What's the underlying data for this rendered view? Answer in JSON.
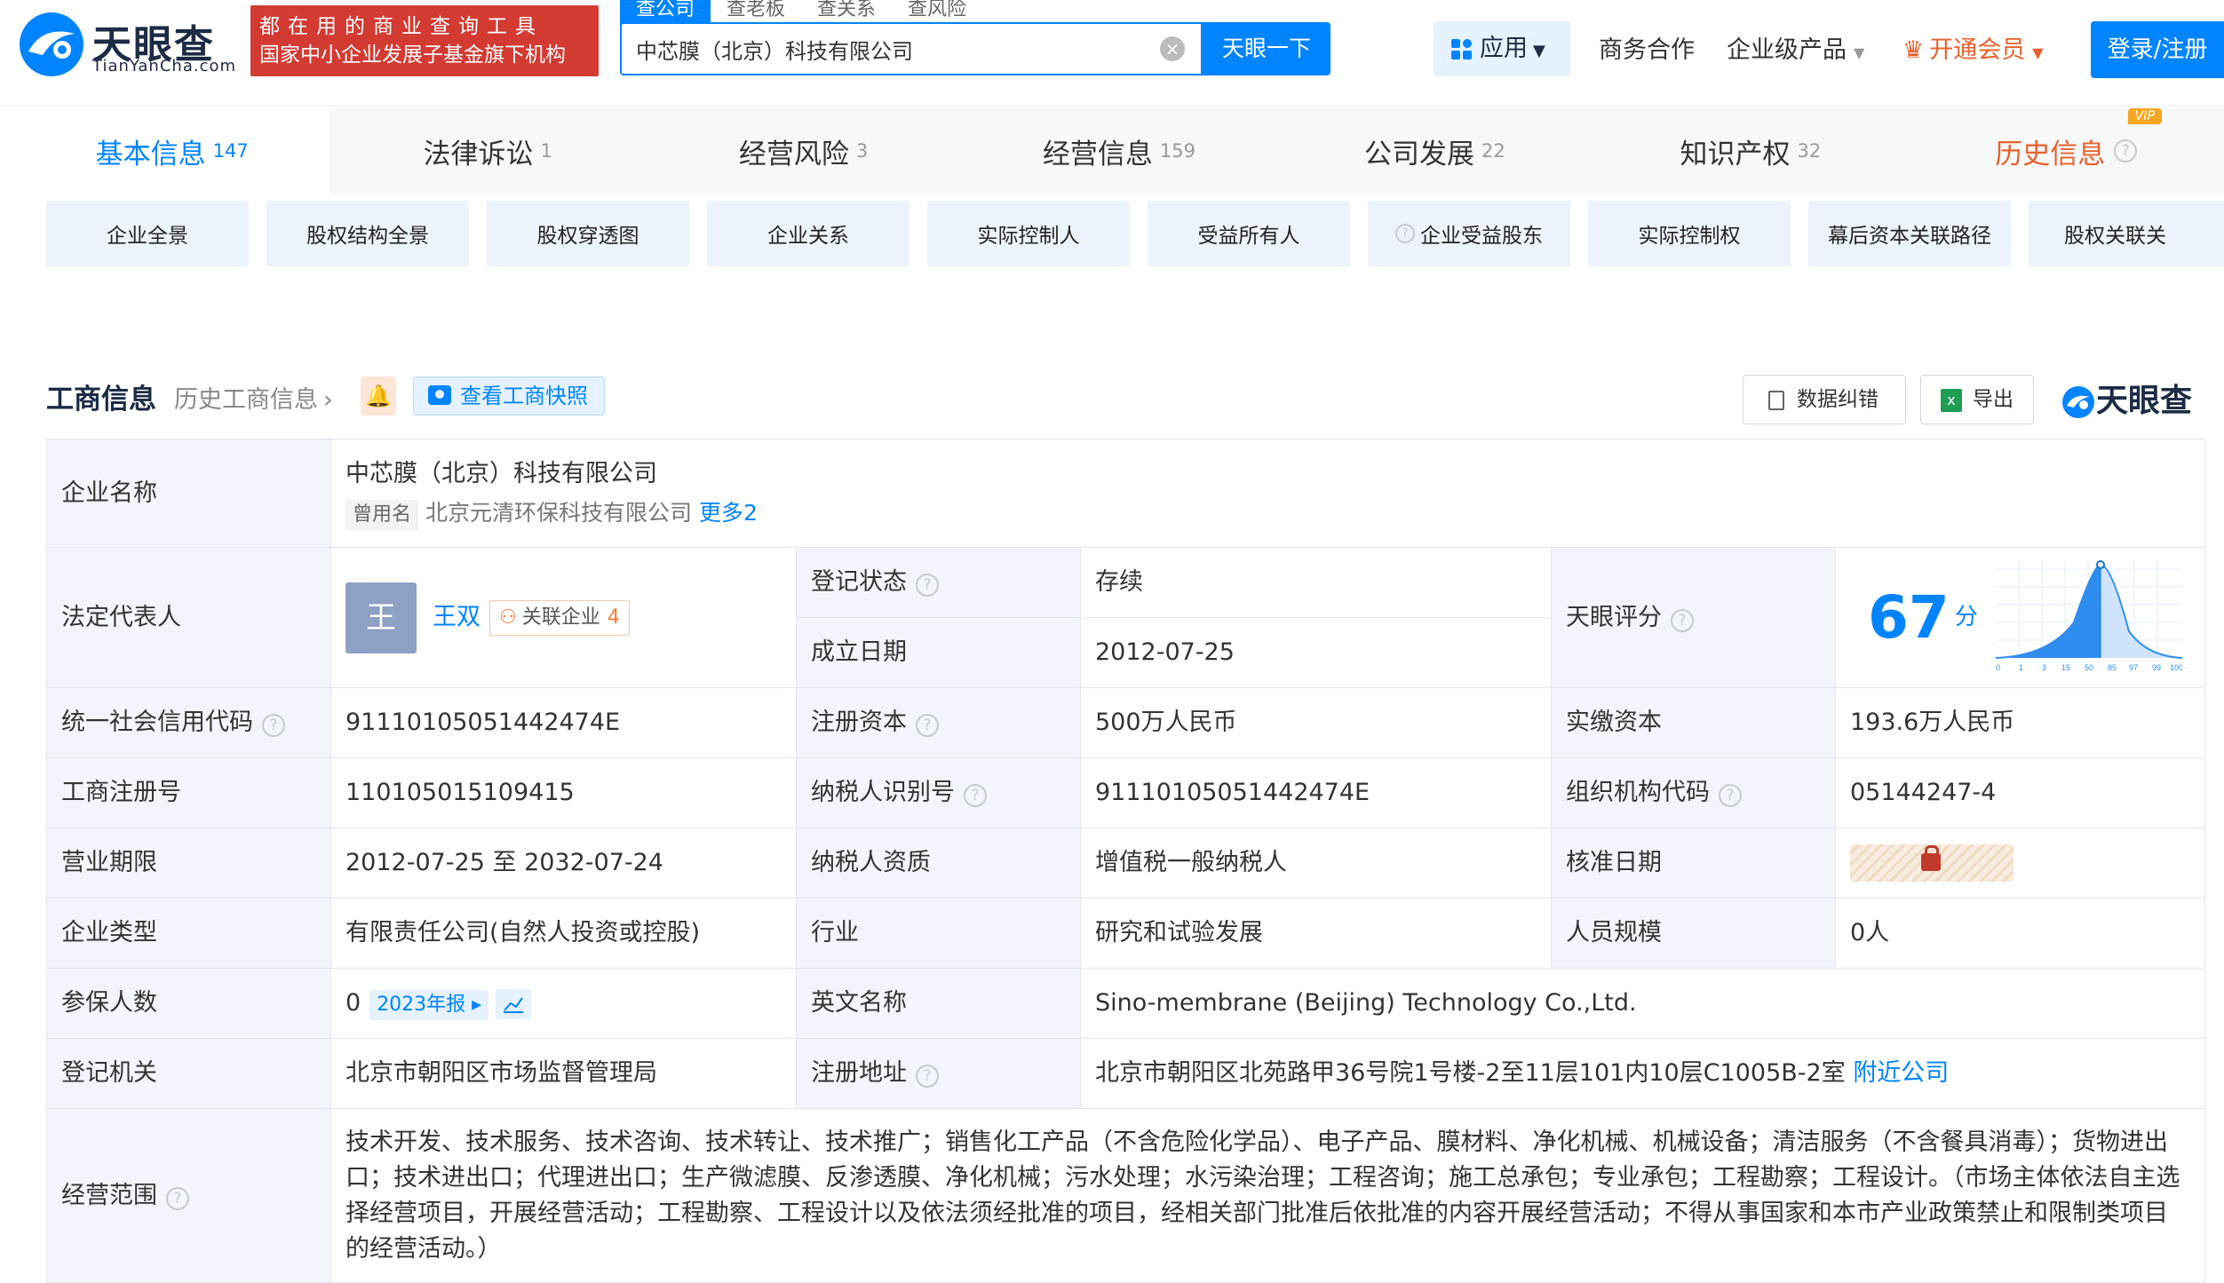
{
  "header": {
    "logo_text": "天眼查",
    "logo_sub": "TianYanCha.com",
    "banner_line1": "都在用的商业查询工具",
    "banner_line2": "国家中小企业发展子基金旗下机构",
    "search_tabs": [
      "查公司",
      "查老板",
      "查关系",
      "查风险"
    ],
    "search_value": "中芯膜（北京）科技有限公司",
    "search_button": "天眼一下",
    "apps": "应用",
    "business": "商务合作",
    "enterprise": "企业级产品",
    "vip": "开通会员",
    "login": "登录/注册"
  },
  "main_tabs": [
    {
      "label": "基本信息",
      "count": "147"
    },
    {
      "label": "法律诉讼",
      "count": "1"
    },
    {
      "label": "经营风险",
      "count": "3"
    },
    {
      "label": "经营信息",
      "count": "159"
    },
    {
      "label": "公司发展",
      "count": "22"
    },
    {
      "label": "知识产权",
      "count": "32"
    },
    {
      "label": "历史信息",
      "count": "",
      "badge": "VIP"
    }
  ],
  "sub_tabs": [
    "企业全景",
    "股权结构全景",
    "股权穿透图",
    "企业关系",
    "实际控制人",
    "受益所有人",
    "企业受益股东",
    "实际控制权",
    "幕后资本关联路径",
    "股权关联关"
  ],
  "section": {
    "title": "工商信息",
    "history_link": "历史工商信息",
    "snapshot": "查看工商快照",
    "correction": "数据纠错",
    "export": "导出",
    "brand": "天眼查"
  },
  "info": {
    "company_name_label": "企业名称",
    "company_name": "中芯膜（北京）科技有限公司",
    "former_tag": "曾用名",
    "former_name": "北京元清环保科技有限公司",
    "more": "更多2",
    "legal_rep_label": "法定代表人",
    "legal_rep_avatar": "王",
    "legal_rep": "王双",
    "related": "关联企业",
    "related_count": "4",
    "reg_status_label": "登记状态",
    "reg_status": "存续",
    "found_date_label": "成立日期",
    "found_date": "2012-07-25",
    "score_label": "天眼评分",
    "score": "67",
    "score_unit": "分",
    "score_axis": [
      "0",
      "1",
      "3",
      "15",
      "50",
      "85",
      "97",
      "99",
      "100"
    ],
    "credit_code_label": "统一社会信用代码",
    "credit_code": "91110105051442474E",
    "reg_capital_label": "注册资本",
    "reg_capital": "500万人民币",
    "paid_capital_label": "实缴资本",
    "paid_capital": "193.6万人民币",
    "reg_no_label": "工商注册号",
    "reg_no": "110105015109415",
    "taxpayer_id_label": "纳税人识别号",
    "taxpayer_id": "91110105051442474E",
    "org_code_label": "组织机构代码",
    "org_code": "05144247-4",
    "term_label": "营业期限",
    "term": "2012-07-25 至 2032-07-24",
    "taxpayer_qual_label": "纳税人资质",
    "taxpayer_qual": "增值税一般纳税人",
    "approve_date_label": "核准日期",
    "type_label": "企业类型",
    "type": "有限责任公司(自然人投资或控股)",
    "industry_label": "行业",
    "industry": "研究和试验发展",
    "staff_label": "人员规模",
    "staff": "0人",
    "insured_label": "参保人数",
    "insured": "0",
    "report_tag": "2023年报",
    "english_name_label": "英文名称",
    "english_name": "Sino-membrane (Beijing) Technology Co.,Ltd.",
    "authority_label": "登记机关",
    "authority": "北京市朝阳区市场监督管理局",
    "address_label": "注册地址",
    "address": "北京市朝阳区北苑路甲36号院1号楼-2至11层101内10层C1005B-2室",
    "nearby": "附近公司",
    "scope_label": "经营范围",
    "scope": "技术开发、技术服务、技术咨询、技术转让、技术推广；销售化工产品（不含危险化学品）、电子产品、膜材料、净化机械、机械设备；清洁服务（不含餐具消毒）；货物进出口；技术进出口；代理进出口；生产微滤膜、反渗透膜、净化机械；污水处理；水污染治理；工程咨询；施工总承包；专业承包；工程勘察；工程设计。（市场主体依法自主选择经营项目，开展经营活动；工程勘察、工程设计以及依法须经批准的项目，经相关部门批准后依批准的内容开展经营活动；不得从事国家和本市产业政策禁止和限制类项目的经营活动。）"
  },
  "colors": {
    "primary": "#0084ff",
    "banner": "#d33a31",
    "vip": "#e8612c",
    "status": "#34a853"
  }
}
